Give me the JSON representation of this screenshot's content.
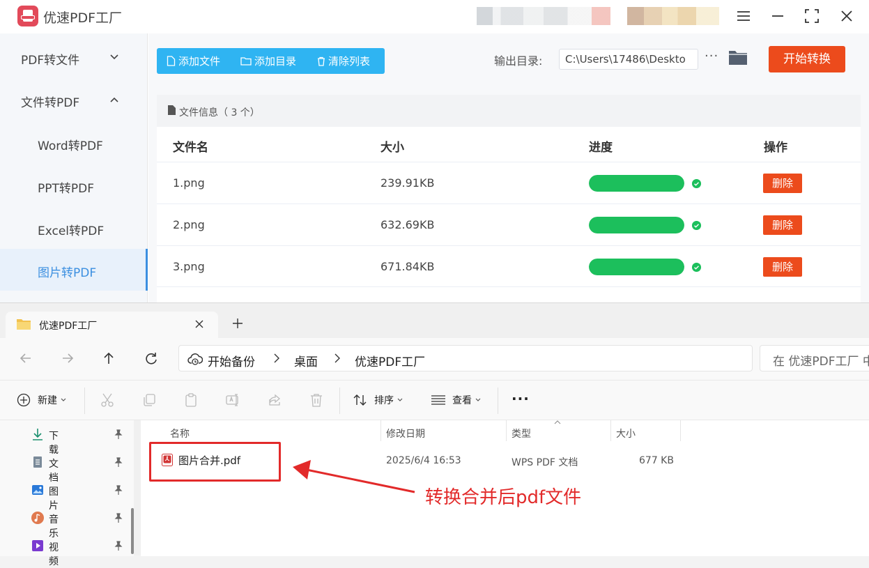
{
  "app": {
    "title": "优速PDF工厂",
    "sidebar": [
      {
        "label": "PDF转文件",
        "expanded": false
      },
      {
        "label": "文件转PDF",
        "expanded": true
      },
      {
        "label": "Word转PDF"
      },
      {
        "label": "PPT转PDF"
      },
      {
        "label": "Excel转PDF"
      },
      {
        "label": "图片转PDF",
        "active": true
      }
    ],
    "toolbar": {
      "add_file": "添加文件",
      "add_dir": "添加目录",
      "clear_list": "清除列表",
      "output_label": "输出目录:",
      "output_path": "C:\\Users\\17486\\Deskto",
      "more": "···",
      "start": "开始转换"
    },
    "file_info": "文件信息（ 3 个）",
    "columns": [
      "文件名",
      "大小",
      "进度",
      "操作"
    ],
    "files": [
      {
        "name": "1.png",
        "size": "239.91KB",
        "progress": 100,
        "action": "删除"
      },
      {
        "name": "2.png",
        "size": "632.69KB",
        "progress": 100,
        "action": "删除"
      },
      {
        "name": "3.png",
        "size": "671.84KB",
        "progress": 100,
        "action": "删除"
      }
    ],
    "colors": {
      "accent": "#2fb4f2",
      "start": "#ec4b1c",
      "progress": "#1cbf5c",
      "active_nav": "#3b8fe0"
    }
  },
  "explorer": {
    "tab_title": "优速PDF工厂",
    "address": {
      "root": "开始备份",
      "seg1": "桌面",
      "seg2": "优速PDF工厂"
    },
    "search_placeholder": "在 优速PDF工厂 中",
    "commands": {
      "new": "新建",
      "sort": "排序",
      "view": "查看",
      "more": "···"
    },
    "quick_access": [
      {
        "label": "下载",
        "icon": "download-icon"
      },
      {
        "label": "文档",
        "icon": "documents-icon"
      },
      {
        "label": "图片",
        "icon": "pictures-icon"
      },
      {
        "label": "音乐",
        "icon": "music-icon"
      },
      {
        "label": "视频",
        "icon": "video-icon"
      }
    ],
    "columns": [
      "名称",
      "修改日期",
      "类型",
      "大小"
    ],
    "file": {
      "name": "图片合并.pdf",
      "modified": "2025/6/4 16:53",
      "type": "WPS PDF 文档",
      "size": "677 KB"
    }
  },
  "annotation": {
    "text": "转换合并后pdf文件",
    "color": "#e22a2a"
  }
}
